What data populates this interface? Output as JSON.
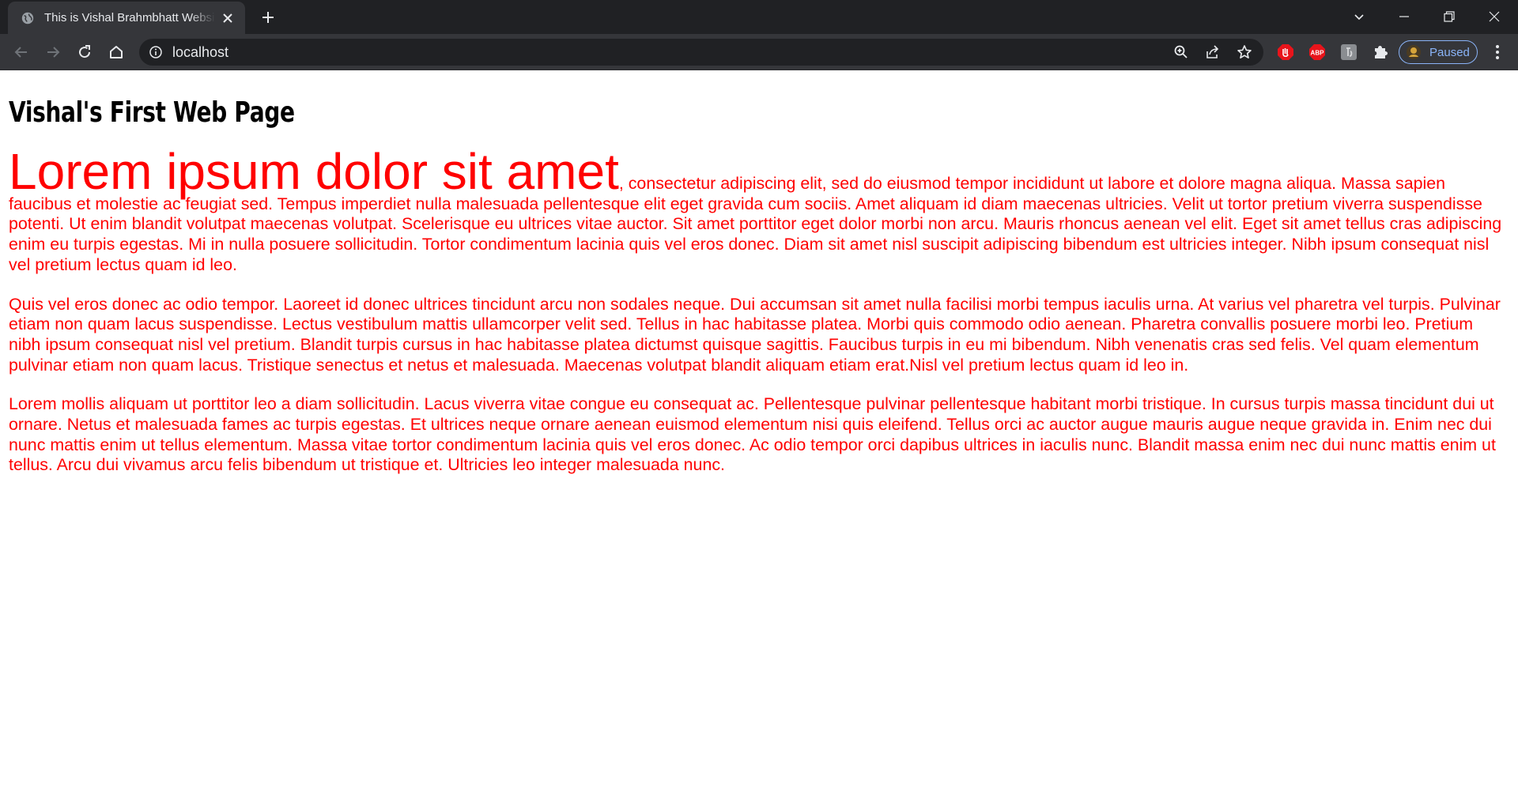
{
  "browser": {
    "tab_title": "This is Vishal Brahmbhatt Website",
    "url": "localhost",
    "profile_status": "Paused",
    "ext_abp_label": "ABP"
  },
  "page": {
    "heading": "Vishal's First Web Page",
    "paragraphs": [
      {
        "lead": "Lorem ipsum dolor sit amet",
        "text": ", consectetur adipiscing elit, sed do eiusmod tempor incididunt ut labore et dolore magna aliqua. Massa sapien faucibus et molestie ac feugiat sed. Tempus imperdiet nulla malesuada pellentesque elit eget gravida cum sociis. Amet aliquam id diam maecenas ultricies. Velit ut tortor pretium viverra suspendisse potenti. Ut enim blandit volutpat maecenas volutpat. Scelerisque eu ultrices vitae auctor. Sit amet porttitor eget dolor morbi non arcu. Mauris rhoncus aenean vel elit. Eget sit amet tellus cras adipiscing enim eu turpis egestas. Mi in nulla posuere sollicitudin. Tortor condimentum lacinia quis vel eros donec. Diam sit amet nisl suscipit adipiscing bibendum est ultricies integer. Nibh ipsum consequat nisl vel pretium lectus quam id leo."
      },
      {
        "text": "Quis vel eros donec ac odio tempor. Laoreet id donec ultrices tincidunt arcu non sodales neque. Dui accumsan sit amet nulla facilisi morbi tempus iaculis urna. At varius vel pharetra vel turpis. Pulvinar etiam non quam lacus suspendisse. Lectus vestibulum mattis ullamcorper velit sed. Tellus in hac habitasse platea. Morbi quis commodo odio aenean. Pharetra convallis posuere morbi leo. Pretium nibh ipsum consequat nisl vel pretium. Blandit turpis cursus in hac habitasse platea dictumst quisque sagittis. Faucibus turpis in eu mi bibendum. Nibh venenatis cras sed felis. Vel quam elementum pulvinar etiam non quam lacus. Tristique senectus et netus et malesuada. Maecenas volutpat blandit aliquam etiam erat.Nisl vel pretium lectus quam id leo in."
      },
      {
        "text": "Lorem mollis aliquam ut porttitor leo a diam sollicitudin. Lacus viverra vitae congue eu consequat ac. Pellentesque pulvinar pellentesque habitant morbi tristique. In cursus turpis massa tincidunt dui ut ornare. Netus et malesuada fames ac turpis egestas. Et ultrices neque ornare aenean euismod elementum nisi quis eleifend. Tellus orci ac auctor augue mauris augue neque gravida in. Enim nec dui nunc mattis enim ut tellus elementum. Massa vitae tortor condimentum lacinia quis vel eros donec. Ac odio tempor orci dapibus ultrices in iaculis nunc. Blandit massa enim nec dui nunc mattis enim ut tellus. Arcu dui vivamus arcu felis bibendum ut tristique et. Ultricies leo integer malesuada nunc."
      }
    ]
  },
  "colors": {
    "paragraph_text": "#ff0000",
    "chrome_dark": "#202124",
    "chrome_tab": "#35363a",
    "profile_accent": "#8ab4f8"
  },
  "icons": [
    "globe-icon",
    "close-icon",
    "plus-icon",
    "chevron-down-icon",
    "minimize-icon",
    "restore-icon",
    "window-close-icon",
    "back-arrow-icon",
    "forward-arrow-icon",
    "reload-icon",
    "home-icon",
    "info-icon",
    "zoom-icon",
    "share-icon",
    "star-icon",
    "stop-sign-icon",
    "abp-icon",
    "extension-gray-icon",
    "puzzle-icon",
    "avatar-icon",
    "kebab-menu-icon"
  ]
}
